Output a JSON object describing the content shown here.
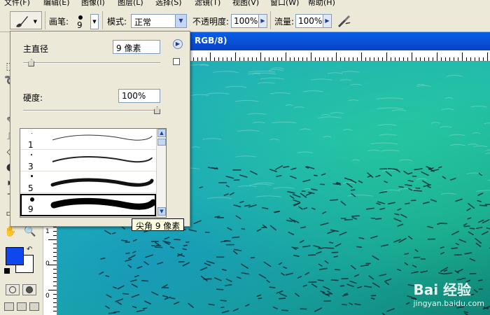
{
  "menubar": {
    "items": [
      "文件(F)",
      "编辑(E)",
      "图像(I)",
      "图层(L)",
      "选择(S)",
      "滤镜(T)",
      "视图(V)",
      "窗口(W)",
      "帮助(H)"
    ]
  },
  "options": {
    "brush_label": "画笔:",
    "brush_size": "9",
    "mode_label": "模式:",
    "mode_value": "正常",
    "opacity_label": "不透明度:",
    "opacity_value": "100%",
    "flow_label": "流量:",
    "flow_value": "100%"
  },
  "document": {
    "title": "RGB/8)"
  },
  "ruler": {
    "left_labels": [
      "1",
      "0",
      "0"
    ]
  },
  "brush_popup": {
    "master_diameter_label": "主直径",
    "master_diameter_value": "9 像素",
    "master_diameter_level": 0.04,
    "hardness_label": "硬度:",
    "hardness_value": "100%",
    "hardness_level": 1.0,
    "brushes": [
      {
        "size": "1",
        "selected": false
      },
      {
        "size": "3",
        "selected": false
      },
      {
        "size": "5",
        "selected": false
      },
      {
        "size": "9",
        "selected": true
      }
    ],
    "tooltip": "尖角 9 像素"
  },
  "watermark": {
    "brand": "Bai 经验",
    "url": "jingyan.baidu.com"
  },
  "colors": {
    "foreground": "#1046ee",
    "background": "#ffffff",
    "title_bar": "#0a5fe6"
  },
  "icons": [
    "brush-icon",
    "hand-icon",
    "zoom-icon",
    "airbrush-icon",
    "swap-colors-icon"
  ]
}
